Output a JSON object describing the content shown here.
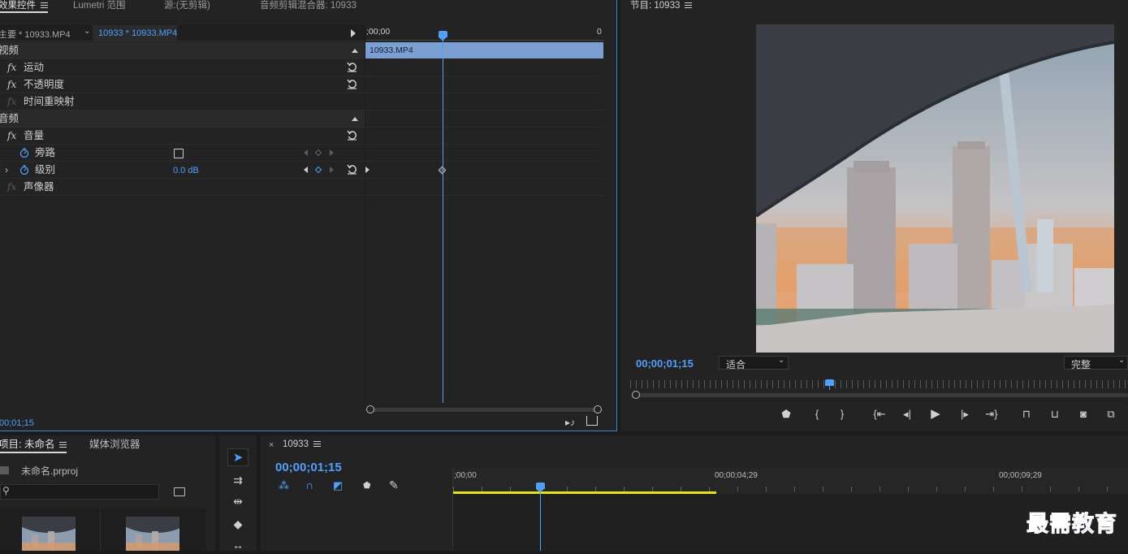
{
  "effect_controls": {
    "tabs": [
      {
        "label": "效果控件",
        "active": true
      },
      {
        "label": "Lumetri 范围",
        "active": false
      },
      {
        "label": "源:(无剪辑)",
        "active": false
      },
      {
        "label": "音频剪辑混合器: 10933",
        "active": false
      }
    ],
    "master_clip": "主要 * 10933.MP4",
    "sequence_clip": "10933 * 10933.MP4",
    "ruler_start": ";00;00",
    "ruler_end": "0",
    "clip_bar_label": "10933.MP4",
    "timecode": "00;01;15",
    "sections": {
      "video": "视频",
      "audio": "音频"
    },
    "effects": {
      "motion": "运动",
      "opacity": "不透明度",
      "time_remap": "时间重映射",
      "volume": "音量",
      "bypass": "旁路",
      "level": "级别",
      "level_value": "0.0 dB",
      "panner": "声像器"
    },
    "fx_symbol": "fx"
  },
  "program_monitor": {
    "title": "节目: 10933",
    "timecode": "00;00;01;15",
    "zoom_select": "适合",
    "quality_select": "完整",
    "playhead_fraction": 0.4
  },
  "project": {
    "tab_project": "项目: 未命名",
    "tab_media": "媒体浏览器",
    "file_name": "未命名.prproj",
    "search_placeholder": ""
  },
  "timeline": {
    "sequence_name": "10933",
    "close_symbol": "×",
    "timecode": "00;00;01;15",
    "ruler_labels": [
      ";00;00",
      "00;00;04;29",
      "00;00;09;29"
    ]
  },
  "watermark": "最需教育",
  "colors": {
    "accent": "#4ea0ff",
    "clip_bar": "#7b9fd1",
    "work_area": "#e6e600",
    "panel_bg": "#232323",
    "focus_border": "#3a86d9"
  }
}
